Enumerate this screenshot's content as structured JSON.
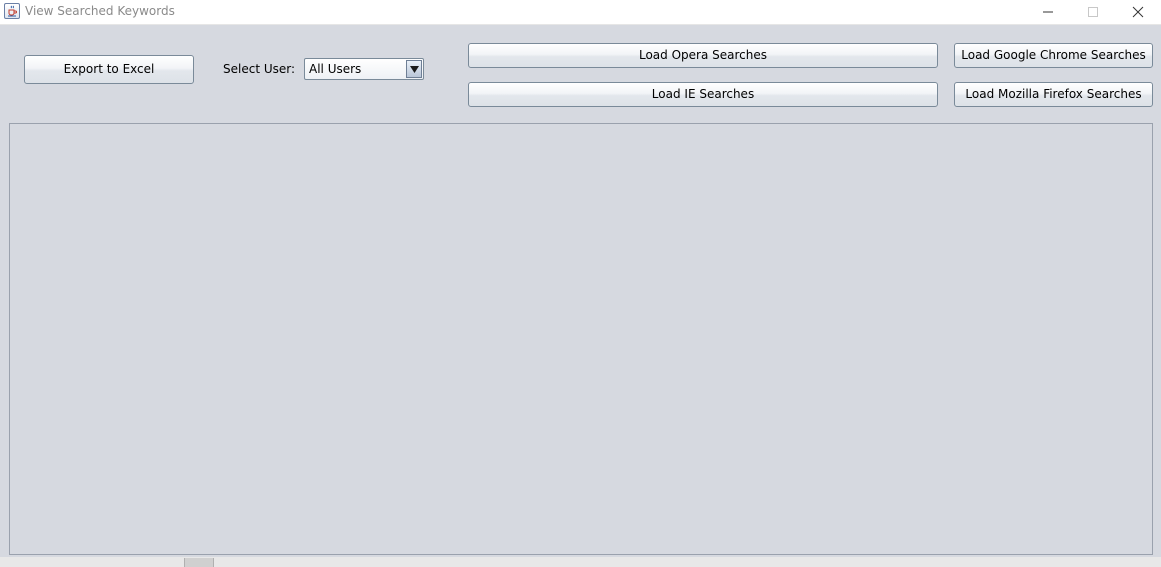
{
  "window": {
    "title": "View Searched Keywords",
    "icon": "java-cup-icon",
    "controls": [
      "minimize-icon",
      "maximize-icon",
      "close-icon"
    ]
  },
  "toolbar": {
    "export_label": "Export to Excel",
    "select_user_label": "Select User:",
    "user_select": {
      "selected": "All Users"
    },
    "buttons": {
      "opera": "Load Opera Searches",
      "ie": "Load IE Searches",
      "chrome": "Load Google Chrome Searches",
      "firefox": "Load Mozilla Firefox Searches"
    }
  },
  "colors": {
    "background": "#d6d9e0",
    "titlebar": "#ffffff",
    "button_border": "#7a8a99"
  }
}
